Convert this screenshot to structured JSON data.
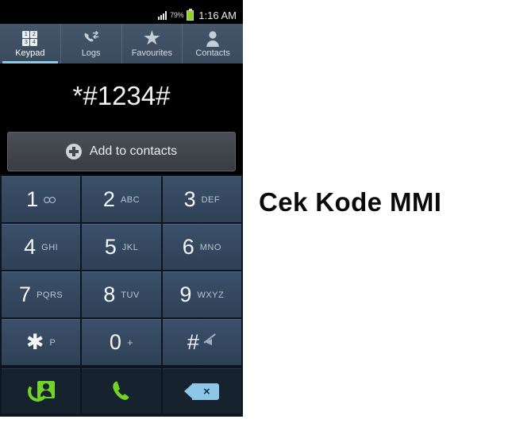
{
  "caption": "Cek Kode MMI",
  "statusbar": {
    "signal_icon": "signal-bars-icon",
    "battery_percent": "79%",
    "battery_icon": "battery-icon",
    "clock": "1:16 AM"
  },
  "tabs": [
    {
      "label": "Keypad",
      "icon": "keypad-grid-icon",
      "active": true,
      "digits": [
        "1",
        "2",
        "3",
        "4"
      ]
    },
    {
      "label": "Logs",
      "icon": "call-logs-icon",
      "active": false
    },
    {
      "label": "Favourites",
      "icon": "star-icon",
      "active": false
    },
    {
      "label": "Contacts",
      "icon": "person-icon",
      "active": false
    }
  ],
  "display": {
    "number": "*#1234#"
  },
  "add_contacts": {
    "label": "Add to contacts",
    "icon": "plus-circle-icon"
  },
  "keypad": [
    {
      "digit": "1",
      "sub": "",
      "icon": "voicemail-icon"
    },
    {
      "digit": "2",
      "sub": "ABC",
      "icon": ""
    },
    {
      "digit": "3",
      "sub": "DEF",
      "icon": ""
    },
    {
      "digit": "4",
      "sub": "GHI",
      "icon": ""
    },
    {
      "digit": "5",
      "sub": "JKL",
      "icon": ""
    },
    {
      "digit": "6",
      "sub": "MNO",
      "icon": ""
    },
    {
      "digit": "7",
      "sub": "PQRS",
      "icon": ""
    },
    {
      "digit": "8",
      "sub": "TUV",
      "icon": ""
    },
    {
      "digit": "9",
      "sub": "WXYZ",
      "icon": ""
    },
    {
      "digit": "✱",
      "sub": "P",
      "icon": ""
    },
    {
      "digit": "0",
      "sub": "+",
      "icon": ""
    },
    {
      "digit": "#",
      "sub": "",
      "icon": "mute-icon"
    }
  ],
  "actions": [
    {
      "name": "video-call-button",
      "icon": "video-call-icon"
    },
    {
      "name": "call-button",
      "icon": "phone-handset-icon"
    },
    {
      "name": "backspace-button",
      "icon": "backspace-icon",
      "glyph": "×"
    }
  ],
  "colors": {
    "accent_blue": "#8fc6e8",
    "key_blue": "#34485f",
    "call_green": "#72d424",
    "battery_green": "#8cd619",
    "tabbar": "#3f5265",
    "screen_black": "#000000"
  }
}
